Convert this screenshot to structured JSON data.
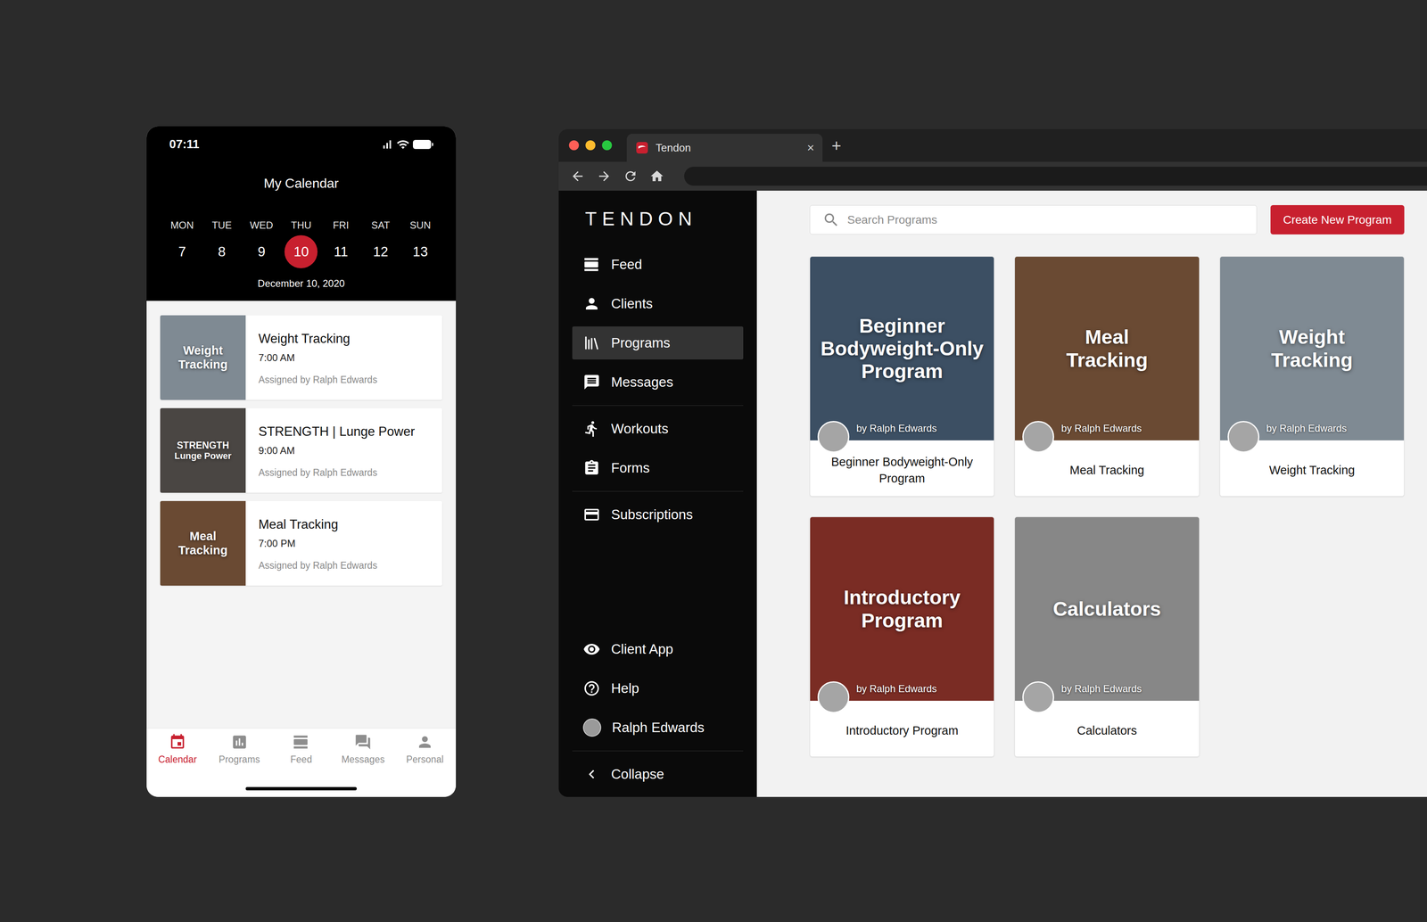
{
  "phone": {
    "status_bar": {
      "time": "07:11"
    },
    "header": {
      "title": "My Calendar"
    },
    "week": [
      {
        "day": "MON",
        "date": "7",
        "selected": false
      },
      {
        "day": "TUE",
        "date": "8",
        "selected": false
      },
      {
        "day": "WED",
        "date": "9",
        "selected": false
      },
      {
        "day": "THU",
        "date": "10",
        "selected": true
      },
      {
        "day": "FRI",
        "date": "11",
        "selected": false
      },
      {
        "day": "SAT",
        "date": "12",
        "selected": false
      },
      {
        "day": "SUN",
        "date": "13",
        "selected": false
      }
    ],
    "date_label": "December 10, 2020",
    "events": [
      {
        "cover_lines": [
          "Weight",
          "Tracking"
        ],
        "title": "Weight Tracking",
        "time": "7:00 AM",
        "assigned": "Assigned by Ralph Edwards",
        "color": "#7f8a93"
      },
      {
        "cover_lines": [
          "STRENGTH",
          "Lunge Power"
        ],
        "title": "STRENGTH | Lunge Power",
        "time": "9:00 AM",
        "assigned": "Assigned by Ralph Edwards",
        "color": "#4a4643"
      },
      {
        "cover_lines": [
          "Meal",
          "Tracking"
        ],
        "title": "Meal Tracking",
        "time": "7:00 PM",
        "assigned": "Assigned by Ralph Edwards",
        "color": "#6a4a33"
      }
    ],
    "nav": [
      {
        "label": "Calendar",
        "selected": true
      },
      {
        "label": "Programs",
        "selected": false
      },
      {
        "label": "Feed",
        "selected": false
      },
      {
        "label": "Messages",
        "selected": false
      },
      {
        "label": "Personal",
        "selected": false
      }
    ]
  },
  "browser": {
    "tab": {
      "title": "Tendon",
      "close": "×"
    },
    "new_tab": "+",
    "app": {
      "logo": "TENDON",
      "sidebar": {
        "groups": [
          [
            {
              "label": "Feed",
              "selected": false
            },
            {
              "label": "Clients",
              "selected": false
            },
            {
              "label": "Programs",
              "selected": true
            },
            {
              "label": "Messages",
              "selected": false
            }
          ],
          [
            {
              "label": "Workouts",
              "selected": false
            },
            {
              "label": "Forms",
              "selected": false
            }
          ],
          [
            {
              "label": "Subscriptions",
              "selected": false
            }
          ]
        ],
        "footer": [
          {
            "label": "Client App",
            "kind": "icon"
          },
          {
            "label": "Help",
            "kind": "icon"
          },
          {
            "label": "Ralph Edwards",
            "kind": "avatar"
          }
        ],
        "collapse": {
          "label": "Collapse"
        }
      },
      "search": {
        "placeholder": "Search Programs"
      },
      "create_button": "Create New Program",
      "programs": [
        {
          "cover_lines": [
            "Beginner",
            "Bodyweight-Only",
            "Program"
          ],
          "author": "by Ralph Edwards",
          "title": "Beginner Bodyweight-Only Program",
          "color": "#3c4f63"
        },
        {
          "cover_lines": [
            "Meal",
            "Tracking"
          ],
          "author": "by Ralph Edwards",
          "title": "Meal Tracking",
          "color": "#6a4a33"
        },
        {
          "cover_lines": [
            "Weight",
            "Tracking"
          ],
          "author": "by Ralph Edwards",
          "title": "Weight Tracking",
          "color": "#7f8a93"
        },
        {
          "cover_lines": [
            "Introductory",
            "Program"
          ],
          "author": "by Ralph Edwards",
          "title": "Introductory Program",
          "color": "#7a2c24"
        },
        {
          "cover_lines": [
            "Calculators"
          ],
          "author": "by Ralph Edwards",
          "title": "Calculators",
          "color": "#878787"
        }
      ]
    }
  }
}
